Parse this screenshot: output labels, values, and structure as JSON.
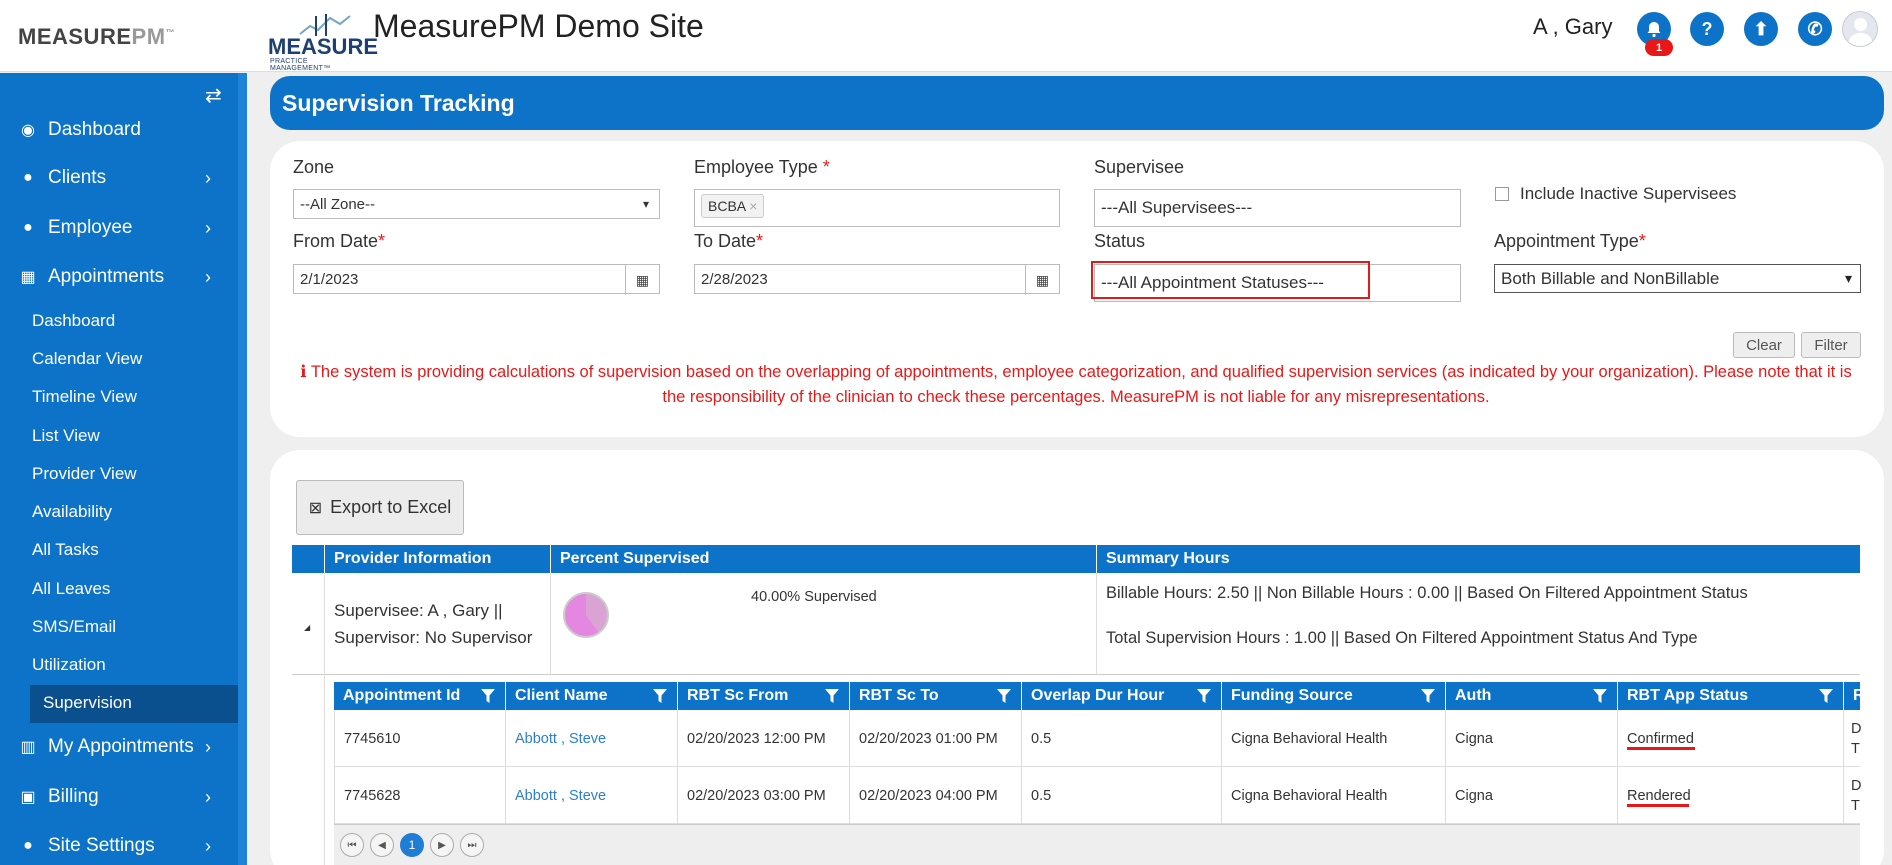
{
  "header": {
    "logo_left": {
      "main": "MEASURE",
      "accent": "PM",
      "tm": "™"
    },
    "logo_center": {
      "word": "MEASURE",
      "tagline": "PRACTICE MANAGEMENT™"
    },
    "site_title": "MeasurePM Demo Site",
    "user_name": "A , Gary",
    "notification_count": "1",
    "icons": [
      "bell-icon",
      "help-icon",
      "upload-icon",
      "phone-icon",
      "avatar"
    ],
    "help_glyph": "?",
    "upload_glyph": "⬆",
    "phone_glyph": "✆",
    "bell_glyph": "🔔"
  },
  "sidebar": {
    "toggle_glyph": "⇄",
    "items": [
      {
        "label": "Dashboard",
        "icon": "tachometer-icon",
        "glyph": "◉",
        "chevron": ""
      },
      {
        "label": "Clients",
        "icon": "user-icon",
        "glyph": "●",
        "chevron": "›"
      },
      {
        "label": "Employee",
        "icon": "users-icon",
        "glyph": "●",
        "chevron": "›"
      },
      {
        "label": "Appointments",
        "icon": "calendar-icon",
        "glyph": "▦",
        "chevron": "›"
      }
    ],
    "sub_items": [
      "Dashboard",
      "Calendar View",
      "Timeline View",
      "List View",
      "Provider View",
      "Availability",
      "All Tasks",
      "All Leaves",
      "SMS/Email",
      "Utilization",
      "Supervision"
    ],
    "bottom_items": [
      {
        "label": "My Appointments",
        "icon": "building-icon",
        "glyph": "▥",
        "chevron": "›"
      },
      {
        "label": "Billing",
        "icon": "money-icon",
        "glyph": "▣",
        "chevron": "›"
      },
      {
        "label": "Site Settings",
        "icon": "user-icon",
        "glyph": "●",
        "chevron": "›"
      }
    ]
  },
  "page": {
    "title": "Supervision Tracking"
  },
  "filters": {
    "zone": {
      "label": "Zone",
      "value": "--All Zone--"
    },
    "employee_type": {
      "label": "Employee Type",
      "required": "*",
      "tag": "BCBA",
      "tag_remove": "×"
    },
    "supervisee": {
      "label": "Supervisee",
      "value": "---All Supervisees---"
    },
    "include_inactive": {
      "label": "Include Inactive Supervisees"
    },
    "from_date": {
      "label": "From Date",
      "required": "*",
      "value": "2/1/2023"
    },
    "to_date": {
      "label": "To Date",
      "required": "*",
      "value": "2/28/2023"
    },
    "status": {
      "label": "Status",
      "value": "---All Appointment Statuses---"
    },
    "appointment_type": {
      "label": "Appointment Type",
      "required": "*",
      "value": "Both Billable and NonBillable"
    },
    "calendar_glyph": "▦",
    "dropdown_glyph": "▾",
    "clear_label": "Clear",
    "filter_label": "Filter",
    "notice_icon": "info-circle-icon",
    "notice_glyph": "ℹ",
    "notice": "The system is providing calculations of supervision based on the overlapping of appointments, employee categorization, and qualified supervision services (as indicated by your organization). Please note that it is the responsibility of the clinician to check these percentages. MeasurePM is not liable for any misrepresentations."
  },
  "results": {
    "export_label": "Export to Excel",
    "export_glyph": "⊠",
    "columns": [
      "Provider Information",
      "Percent Supervised",
      "Summary Hours"
    ],
    "row": {
      "expand_glyph": "◢",
      "supervisee_line": "Supervisee: A , Gary ||",
      "supervisor_line": "Supervisor: No Supervisor",
      "percent_text": "40.00% Supervised",
      "percent_value": 40,
      "summary_line1": "Billable Hours: 2.50 || Non Billable Hours : 0.00 || Based On Filtered Appointment Status",
      "summary_line2": "Total Supervision Hours : 1.00 || Based On Filtered Appointment Status And Type"
    },
    "inner_columns": [
      "Appointment Id",
      "Client Name",
      "RBT Sc From",
      "RBT Sc To",
      "Overlap Dur Hour",
      "Funding Source",
      "Auth",
      "RBT App Status",
      "R"
    ],
    "inner_rows": [
      {
        "id": "7745610",
        "client": "Abbott , Steve",
        "from": "02/20/2023 12:00 PM",
        "to": "02/20/2023 01:00 PM",
        "overlap": "0.5",
        "funding": "Cigna Behavioral Health",
        "auth": "Cigna",
        "status": "Confirmed",
        "extra1": "D",
        "extra2": "T"
      },
      {
        "id": "7745628",
        "client": "Abbott , Steve",
        "from": "02/20/2023 03:00 PM",
        "to": "02/20/2023 04:00 PM",
        "overlap": "0.5",
        "funding": "Cigna Behavioral Health",
        "auth": "Cigna",
        "status": "Rendered",
        "extra1": "D",
        "extra2": "T"
      }
    ],
    "pager": {
      "first": "⏮",
      "prev": "◀",
      "page": "1",
      "next": "▶",
      "last": "⏭"
    }
  },
  "colors": {
    "primary": "#0c73c8",
    "danger": "#e81818",
    "active_nav": "#0a4f8e"
  }
}
